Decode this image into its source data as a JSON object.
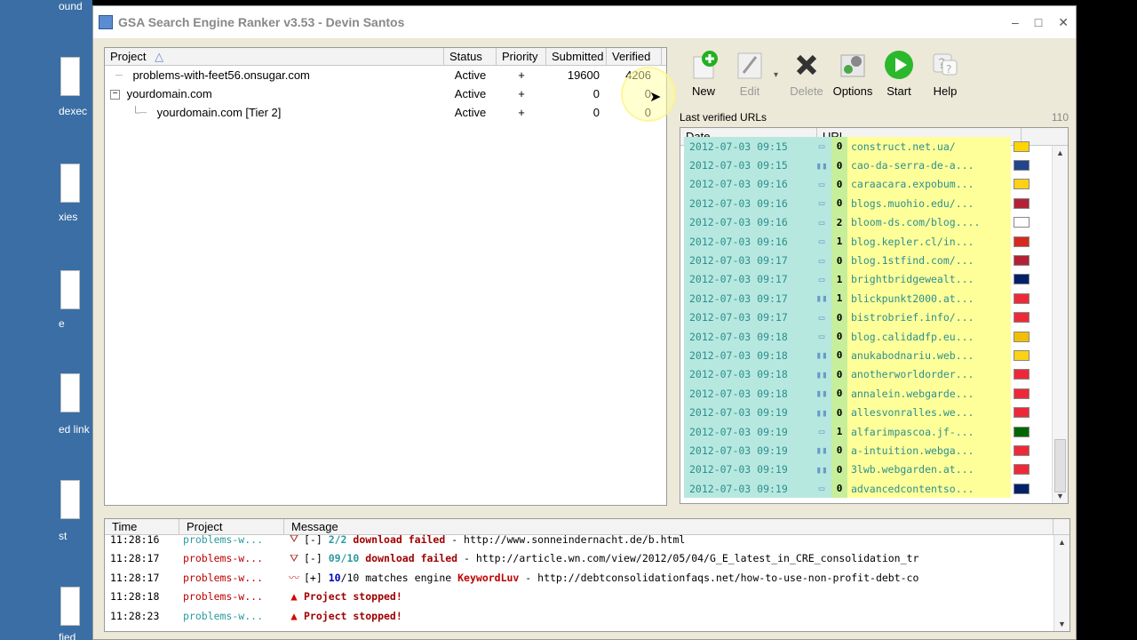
{
  "desktop": {
    "labels": [
      "ound",
      "dexec",
      "xies",
      "e",
      "ed link",
      "st",
      "fied"
    ]
  },
  "window": {
    "title": "GSA Search Engine Ranker v3.53 - Devin Santos",
    "controls": {
      "minimize": "–",
      "maximize": "□",
      "close": "✕"
    }
  },
  "projects": {
    "headers": {
      "project": "Project",
      "status": "Status",
      "priority": "Priority",
      "submitted": "Submitted",
      "verified": "Verified"
    },
    "sort_indicator": "△",
    "rows": [
      {
        "name": "problems-with-feet56.onsugar.com",
        "status": "Active",
        "priority": "+",
        "submitted": "19600",
        "verified": "4206",
        "tree": ""
      },
      {
        "name": "yourdomain.com",
        "status": "Active",
        "priority": "+",
        "submitted": "0",
        "verified": "0",
        "tree": "−"
      },
      {
        "name": "yourdomain.com [Tier 2]",
        "status": "Active",
        "priority": "+",
        "submitted": "0",
        "verified": "0",
        "tree": ""
      }
    ]
  },
  "toolbar": {
    "new": "New",
    "edit": "Edit",
    "delete": "Delete",
    "options": "Options",
    "start": "Start",
    "help": "Help"
  },
  "verified_urls": {
    "title": "Last verified URLs",
    "count": "110",
    "headers": {
      "date": "Date",
      "url": "URL"
    },
    "rows": [
      {
        "date": "2012-07-03 09:15",
        "icon": "comment",
        "num": "0",
        "url": "construct.net.ua/",
        "flag": "#ffd500"
      },
      {
        "date": "2012-07-03 09:15",
        "icon": "book",
        "num": "0",
        "url": "cao-da-serra-de-a...",
        "flag": "#21468b"
      },
      {
        "date": "2012-07-03 09:16",
        "icon": "comment",
        "num": "0",
        "url": "caraacara.expobum...",
        "flag": "#fcd116"
      },
      {
        "date": "2012-07-03 09:16",
        "icon": "comment",
        "num": "0",
        "url": "blogs.muohio.edu/...",
        "flag": "#b22234"
      },
      {
        "date": "2012-07-03 09:16",
        "icon": "comment",
        "num": "2",
        "url": "bloom-ds.com/blog....",
        "flag": "#ffffff"
      },
      {
        "date": "2012-07-03 09:16",
        "icon": "comment",
        "num": "1",
        "url": "blog.kepler.cl/in...",
        "flag": "#d52b1e"
      },
      {
        "date": "2012-07-03 09:17",
        "icon": "comment",
        "num": "0",
        "url": "blog.1stfind.com/...",
        "flag": "#b22234"
      },
      {
        "date": "2012-07-03 09:17",
        "icon": "comment",
        "num": "1",
        "url": "brightbridgewealt...",
        "flag": "#012169"
      },
      {
        "date": "2012-07-03 09:17",
        "icon": "book",
        "num": "1",
        "url": "blickpunkt2000.at...",
        "flag": "#ed2939"
      },
      {
        "date": "2012-07-03 09:17",
        "icon": "comment",
        "num": "0",
        "url": "bistrobrief.info/...",
        "flag": "#ed2939"
      },
      {
        "date": "2012-07-03 09:18",
        "icon": "comment",
        "num": "0",
        "url": "blog.calidadfp.eu...",
        "flag": "#f1bf00"
      },
      {
        "date": "2012-07-03 09:18",
        "icon": "book",
        "num": "0",
        "url": "anukabodnariu.web...",
        "flag": "#fcd116"
      },
      {
        "date": "2012-07-03 09:18",
        "icon": "book",
        "num": "0",
        "url": "anotherworldorder...",
        "flag": "#ed2939"
      },
      {
        "date": "2012-07-03 09:18",
        "icon": "book",
        "num": "0",
        "url": "annalein.webgarde...",
        "flag": "#ed2939"
      },
      {
        "date": "2012-07-03 09:19",
        "icon": "book",
        "num": "0",
        "url": "allesvonralles.we...",
        "flag": "#ed2939"
      },
      {
        "date": "2012-07-03 09:19",
        "icon": "comment",
        "num": "1",
        "url": "alfarimpascoa.jf-...",
        "flag": "#006600"
      },
      {
        "date": "2012-07-03 09:19",
        "icon": "book",
        "num": "0",
        "url": "a-intuition.webga...",
        "flag": "#ed2939"
      },
      {
        "date": "2012-07-03 09:19",
        "icon": "book",
        "num": "0",
        "url": "3lwb.webgarden.at...",
        "flag": "#ed2939"
      },
      {
        "date": "2012-07-03 09:19",
        "icon": "comment",
        "num": "0",
        "url": "advancedcontentso...",
        "flag": "#012169"
      }
    ]
  },
  "log": {
    "headers": {
      "time": "Time",
      "project": "Project",
      "message": "Message"
    },
    "rows": [
      {
        "time": "11:28:16",
        "project": "problems-w...",
        "project_color": "#2c9aa0",
        "icon": "filter",
        "parts": [
          {
            "t": "[-] ",
            "c": "dark"
          },
          {
            "t": "2/2",
            "c": "cyan"
          },
          {
            "t": " download failed",
            "c": "darkred-b"
          },
          {
            "t": " - http://www.sonneindernacht.de/b.html",
            "c": "dark"
          }
        ]
      },
      {
        "time": "11:28:17",
        "project": "problems-w...",
        "project_color": "#c00000",
        "icon": "filter",
        "parts": [
          {
            "t": "[-] ",
            "c": "dark"
          },
          {
            "t": "09/10",
            "c": "cyan"
          },
          {
            "t": " download failed",
            "c": "darkred-b"
          },
          {
            "t": " - http://article.wn.com/view/2012/05/04/G_E_latest_in_CRE_consolidation_tr",
            "c": "dark"
          }
        ]
      },
      {
        "time": "11:28:17",
        "project": "problems-w...",
        "project_color": "#c00000",
        "icon": "chart",
        "parts": [
          {
            "t": "[+] ",
            "c": "dark"
          },
          {
            "t": "10",
            "c": "blue"
          },
          {
            "t": "/10 matches engine ",
            "c": "dark"
          },
          {
            "t": "KeywordLuv",
            "c": "red"
          },
          {
            "t": " - http://debtconsolidationfaqs.net/how-to-use-non-profit-debt-co",
            "c": "dark"
          }
        ]
      },
      {
        "time": "11:28:18",
        "project": "problems-w...",
        "project_color": "#c00000",
        "icon": "warn",
        "parts": [
          {
            "t": "Project stopped!",
            "c": "darkred-b"
          }
        ]
      },
      {
        "time": "11:28:23",
        "project": "problems-w...",
        "project_color": "#2c9aa0",
        "icon": "warn",
        "parts": [
          {
            "t": "Project stopped!",
            "c": "darkred-b"
          }
        ]
      }
    ]
  }
}
